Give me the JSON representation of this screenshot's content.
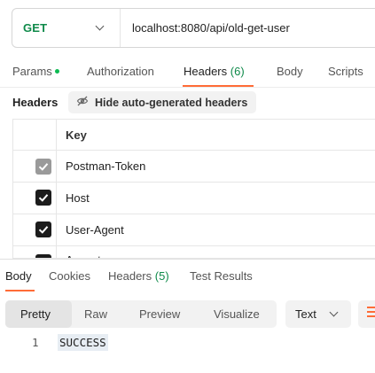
{
  "request": {
    "method": "GET",
    "url": "localhost:8080/api/old-get-user"
  },
  "request_tabs": [
    {
      "label": "Params",
      "has_dot": true
    },
    {
      "label": "Authorization"
    },
    {
      "label": "Headers",
      "count": "(6)",
      "active": true
    },
    {
      "label": "Body"
    },
    {
      "label": "Scripts"
    }
  ],
  "headers_panel": {
    "title": "Headers",
    "hide_auto_label": "Hide auto-generated headers",
    "column_key": "Key",
    "rows": [
      {
        "key": "Postman-Token",
        "checked": true,
        "disabled": true
      },
      {
        "key": "Host",
        "checked": true
      },
      {
        "key": "User-Agent",
        "checked": true
      },
      {
        "key": "Accept",
        "checked": true
      }
    ]
  },
  "response_tabs": [
    {
      "label": "Body",
      "active": true
    },
    {
      "label": "Cookies"
    },
    {
      "label": "Headers",
      "count": "(5)"
    },
    {
      "label": "Test Results"
    }
  ],
  "response_format": {
    "options": [
      "Pretty",
      "Raw",
      "Preview",
      "Visualize"
    ],
    "selected": "Pretty",
    "type_selected": "Text"
  },
  "response_body": {
    "lines": [
      {
        "number": "1",
        "text": "SUCCESS"
      }
    ]
  },
  "colors": {
    "accent": "#ff6c37",
    "method_get": "#0f8a4a",
    "active_dot": "#0cbb52"
  }
}
